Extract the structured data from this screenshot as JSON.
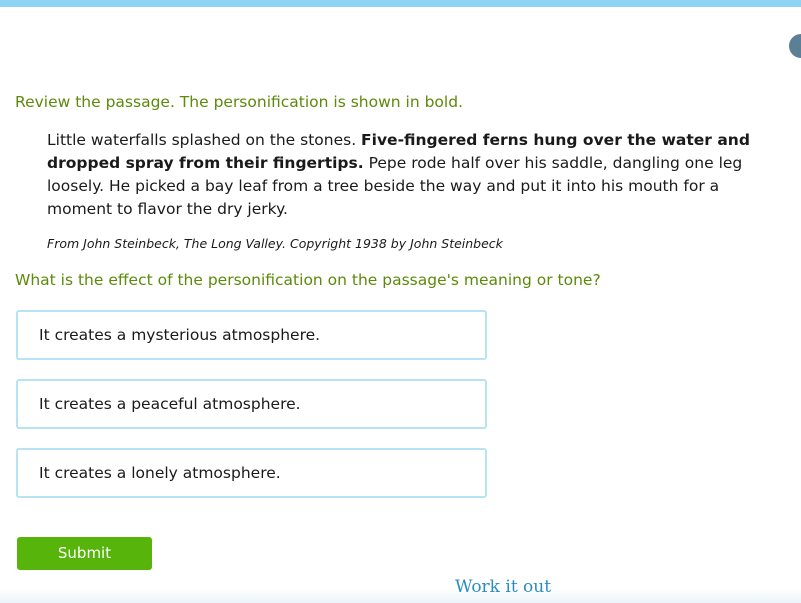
{
  "instruction": "Review the passage. The personification is shown in bold.",
  "passage": {
    "text_before": "Little waterfalls splashed on the stones. ",
    "bold": "Five-fingered ferns hung over the water and dropped spray from their fingertips.",
    "text_after": " Pepe rode half over his saddle, dangling one leg loosely. He picked a bay leaf from a tree beside the way and put it into his mouth for a moment to flavor the dry jerky."
  },
  "citation": "From John Steinbeck, The Long Valley. Copyright 1938 by John Steinbeck",
  "question": "What is the effect of the personification on the passage's meaning or tone?",
  "choices": [
    "It creates a mysterious atmosphere.",
    "It creates a peaceful atmosphere.",
    "It creates a lonely atmosphere."
  ],
  "submit_label": "Submit",
  "work_it_out_label": "Work it out",
  "colors": {
    "accent_green": "#5c8a0a",
    "submit_green": "#56b40a",
    "choice_border": "#b7e3f5",
    "top_bar": "#8fd3f4",
    "link_blue": "#2b8cc4"
  }
}
